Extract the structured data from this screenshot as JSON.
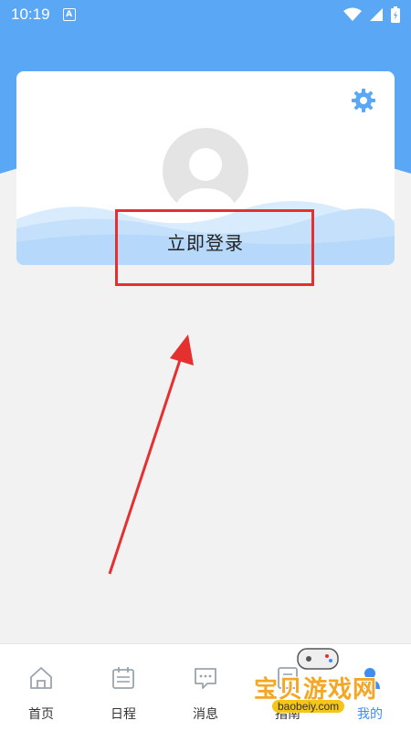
{
  "status_bar": {
    "time": "10:19",
    "notification_letter": "A"
  },
  "profile": {
    "login_label": "立即登录"
  },
  "bottom_nav": {
    "items": [
      {
        "label": "首页",
        "icon": "home-icon"
      },
      {
        "label": "日程",
        "icon": "calendar-icon"
      },
      {
        "label": "消息",
        "icon": "message-icon"
      },
      {
        "label": "指南",
        "icon": "guide-icon"
      },
      {
        "label": "我的",
        "icon": "person-icon",
        "active": true
      }
    ]
  },
  "watermark": {
    "text": "宝贝游戏网",
    "url": "baobeiy.com"
  },
  "colors": {
    "header_blue": "#5aa8f5",
    "accent_blue": "#3d8ef0",
    "annotation_red": "#e53030",
    "watermark_orange": "#f5a623"
  }
}
